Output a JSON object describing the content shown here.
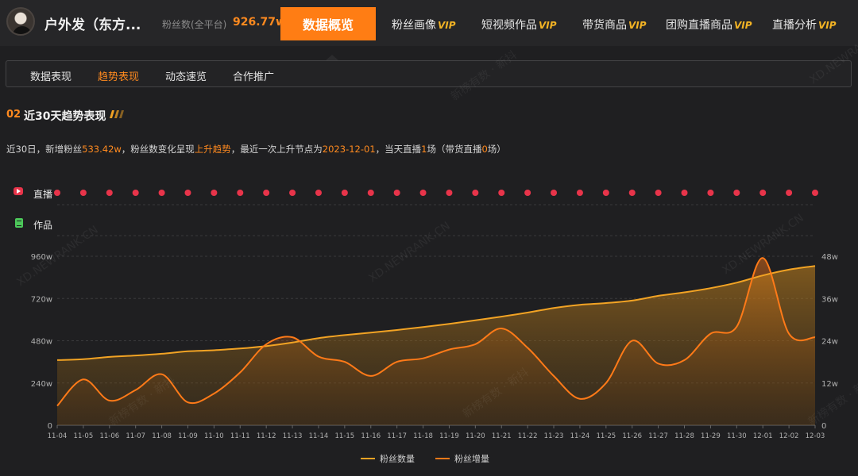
{
  "header": {
    "account_name": "户外发（东方...",
    "fans_label": "粉丝数(全平台)",
    "fans_value": "926.77w",
    "active_tab": "数据概览",
    "tabs": [
      {
        "label": "粉丝画像",
        "vip": "VIP"
      },
      {
        "label": "短视频作品",
        "vip": "VIP"
      },
      {
        "label": "带货商品",
        "vip": "VIP"
      },
      {
        "label": "团购直播商品",
        "vip": "VIP"
      },
      {
        "label": "直播分析",
        "vip": "VIP"
      }
    ]
  },
  "subnav": {
    "items": [
      "数据表现",
      "趋势表现",
      "动态速览",
      "合作推广"
    ],
    "active_index": 1
  },
  "section": {
    "number": "02",
    "title": "近30天趋势表现",
    "summary": {
      "p1": "近30日，新增粉丝",
      "new_fans": "533.42w",
      "p2": "，粉丝数变化呈现",
      "trend": "上升趋势",
      "p3": "，最近一次上升节点为",
      "date": "2023-12-01",
      "p4": "，当天直播",
      "live_count": "1",
      "p5": "场（带货直播",
      "sale_live_count": "0",
      "p6": "场）"
    }
  },
  "rows": {
    "live": "直播",
    "works": "作品"
  },
  "colors": {
    "accent": "#ff7d14",
    "line1": "#f2a324",
    "line2": "#ff7a18",
    "live_dot": "#e8344a",
    "background": "#1f1f21"
  },
  "watermarks": [
    "新榜有数 · 新抖",
    "XD.NEWRANK.CN"
  ],
  "chart_data": {
    "type": "line",
    "x": [
      "11-04",
      "11-05",
      "11-06",
      "11-07",
      "11-08",
      "11-09",
      "11-10",
      "11-11",
      "11-12",
      "11-13",
      "11-14",
      "11-15",
      "11-16",
      "11-17",
      "11-18",
      "11-19",
      "11-20",
      "11-21",
      "11-22",
      "11-23",
      "11-24",
      "11-25",
      "11-26",
      "11-27",
      "11-28",
      "11-29",
      "11-30",
      "12-01",
      "12-02",
      "12-03"
    ],
    "y_left": {
      "ticks": [
        "0",
        "240w",
        "480w",
        "720w",
        "960w"
      ],
      "ylim": [
        0,
        960
      ]
    },
    "y_right": {
      "ticks": [
        "0",
        "12w",
        "24w",
        "36w",
        "48w"
      ],
      "ylim": [
        0,
        48
      ]
    },
    "series": [
      {
        "name": "粉丝数量",
        "axis": "left",
        "values": [
          370,
          375,
          388,
          396,
          406,
          420,
          426,
          436,
          450,
          470,
          495,
          512,
          526,
          541,
          558,
          576,
          596,
          617,
          640,
          666,
          684,
          694,
          708,
          735,
          755,
          779,
          810,
          851,
          884,
          905
        ]
      },
      {
        "name": "粉丝增量",
        "axis": "right",
        "values": [
          5.5,
          13,
          7,
          10,
          14.5,
          6.5,
          9,
          15,
          23,
          25,
          19.5,
          18,
          14,
          18,
          19,
          21.5,
          23,
          27.5,
          22,
          14,
          7.5,
          12,
          24,
          17.5,
          18.5,
          26,
          28,
          47.5,
          26,
          25
        ]
      }
    ],
    "live_markers": [
      1,
      1,
      1,
      1,
      1,
      1,
      1,
      1,
      1,
      1,
      1,
      1,
      1,
      1,
      1,
      1,
      1,
      1,
      1,
      1,
      1,
      1,
      1,
      1,
      1,
      1,
      1,
      1,
      1,
      1
    ],
    "grid": true,
    "legend_position": "bottom"
  }
}
